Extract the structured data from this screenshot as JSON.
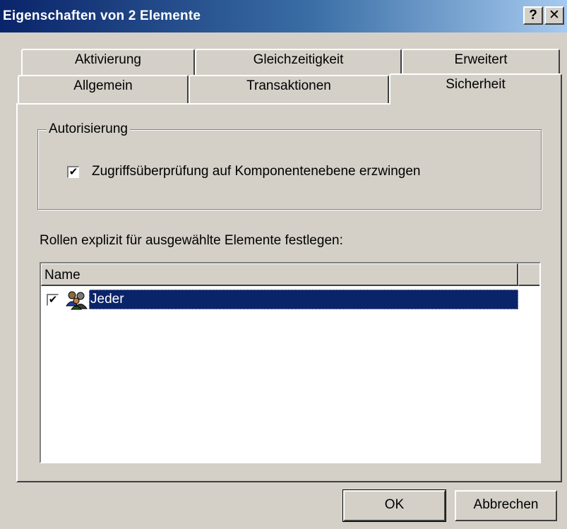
{
  "window": {
    "title": "Eigenschaften von 2 Elemente",
    "help_label": "?",
    "close_label": "✕"
  },
  "tabs": {
    "row1": [
      {
        "label": "Aktivierung"
      },
      {
        "label": "Gleichzeitigkeit"
      },
      {
        "label": "Erweitert"
      }
    ],
    "row2": [
      {
        "label": "Allgemein"
      },
      {
        "label": "Transaktionen"
      },
      {
        "label": "Sicherheit",
        "active": true
      }
    ]
  },
  "authorization": {
    "group_label": "Autorisierung",
    "checkbox_label": "Zugriffsüberprüfung auf Komponentenebene erzwingen",
    "checked": true
  },
  "roles": {
    "label": "Rollen explizit für ausgewählte Elemente festlegen:",
    "column_header": "Name",
    "items": [
      {
        "name": "Jeder",
        "checked": true,
        "selected": true,
        "icon": "user-group-icon"
      }
    ]
  },
  "buttons": {
    "ok": "OK",
    "cancel": "Abbrechen"
  },
  "colors": {
    "titlebar_start": "#0a246a",
    "titlebar_end": "#a6caf0",
    "face": "#d4d0c8",
    "selection": "#0a246a"
  }
}
